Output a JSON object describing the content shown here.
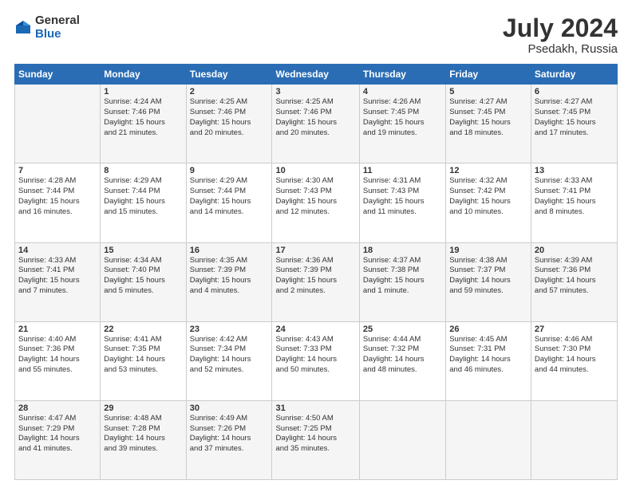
{
  "header": {
    "logo_general": "General",
    "logo_blue": "Blue",
    "title": "July 2024",
    "location": "Psedakh, Russia"
  },
  "weekdays": [
    "Sunday",
    "Monday",
    "Tuesday",
    "Wednesday",
    "Thursday",
    "Friday",
    "Saturday"
  ],
  "weeks": [
    [
      {
        "day": "",
        "info": ""
      },
      {
        "day": "1",
        "info": "Sunrise: 4:24 AM\nSunset: 7:46 PM\nDaylight: 15 hours\nand 21 minutes."
      },
      {
        "day": "2",
        "info": "Sunrise: 4:25 AM\nSunset: 7:46 PM\nDaylight: 15 hours\nand 20 minutes."
      },
      {
        "day": "3",
        "info": "Sunrise: 4:25 AM\nSunset: 7:46 PM\nDaylight: 15 hours\nand 20 minutes."
      },
      {
        "day": "4",
        "info": "Sunrise: 4:26 AM\nSunset: 7:45 PM\nDaylight: 15 hours\nand 19 minutes."
      },
      {
        "day": "5",
        "info": "Sunrise: 4:27 AM\nSunset: 7:45 PM\nDaylight: 15 hours\nand 18 minutes."
      },
      {
        "day": "6",
        "info": "Sunrise: 4:27 AM\nSunset: 7:45 PM\nDaylight: 15 hours\nand 17 minutes."
      }
    ],
    [
      {
        "day": "7",
        "info": "Sunrise: 4:28 AM\nSunset: 7:44 PM\nDaylight: 15 hours\nand 16 minutes."
      },
      {
        "day": "8",
        "info": "Sunrise: 4:29 AM\nSunset: 7:44 PM\nDaylight: 15 hours\nand 15 minutes."
      },
      {
        "day": "9",
        "info": "Sunrise: 4:29 AM\nSunset: 7:44 PM\nDaylight: 15 hours\nand 14 minutes."
      },
      {
        "day": "10",
        "info": "Sunrise: 4:30 AM\nSunset: 7:43 PM\nDaylight: 15 hours\nand 12 minutes."
      },
      {
        "day": "11",
        "info": "Sunrise: 4:31 AM\nSunset: 7:43 PM\nDaylight: 15 hours\nand 11 minutes."
      },
      {
        "day": "12",
        "info": "Sunrise: 4:32 AM\nSunset: 7:42 PM\nDaylight: 15 hours\nand 10 minutes."
      },
      {
        "day": "13",
        "info": "Sunrise: 4:33 AM\nSunset: 7:41 PM\nDaylight: 15 hours\nand 8 minutes."
      }
    ],
    [
      {
        "day": "14",
        "info": "Sunrise: 4:33 AM\nSunset: 7:41 PM\nDaylight: 15 hours\nand 7 minutes."
      },
      {
        "day": "15",
        "info": "Sunrise: 4:34 AM\nSunset: 7:40 PM\nDaylight: 15 hours\nand 5 minutes."
      },
      {
        "day": "16",
        "info": "Sunrise: 4:35 AM\nSunset: 7:39 PM\nDaylight: 15 hours\nand 4 minutes."
      },
      {
        "day": "17",
        "info": "Sunrise: 4:36 AM\nSunset: 7:39 PM\nDaylight: 15 hours\nand 2 minutes."
      },
      {
        "day": "18",
        "info": "Sunrise: 4:37 AM\nSunset: 7:38 PM\nDaylight: 15 hours\nand 1 minute."
      },
      {
        "day": "19",
        "info": "Sunrise: 4:38 AM\nSunset: 7:37 PM\nDaylight: 14 hours\nand 59 minutes."
      },
      {
        "day": "20",
        "info": "Sunrise: 4:39 AM\nSunset: 7:36 PM\nDaylight: 14 hours\nand 57 minutes."
      }
    ],
    [
      {
        "day": "21",
        "info": "Sunrise: 4:40 AM\nSunset: 7:36 PM\nDaylight: 14 hours\nand 55 minutes."
      },
      {
        "day": "22",
        "info": "Sunrise: 4:41 AM\nSunset: 7:35 PM\nDaylight: 14 hours\nand 53 minutes."
      },
      {
        "day": "23",
        "info": "Sunrise: 4:42 AM\nSunset: 7:34 PM\nDaylight: 14 hours\nand 52 minutes."
      },
      {
        "day": "24",
        "info": "Sunrise: 4:43 AM\nSunset: 7:33 PM\nDaylight: 14 hours\nand 50 minutes."
      },
      {
        "day": "25",
        "info": "Sunrise: 4:44 AM\nSunset: 7:32 PM\nDaylight: 14 hours\nand 48 minutes."
      },
      {
        "day": "26",
        "info": "Sunrise: 4:45 AM\nSunset: 7:31 PM\nDaylight: 14 hours\nand 46 minutes."
      },
      {
        "day": "27",
        "info": "Sunrise: 4:46 AM\nSunset: 7:30 PM\nDaylight: 14 hours\nand 44 minutes."
      }
    ],
    [
      {
        "day": "28",
        "info": "Sunrise: 4:47 AM\nSunset: 7:29 PM\nDaylight: 14 hours\nand 41 minutes."
      },
      {
        "day": "29",
        "info": "Sunrise: 4:48 AM\nSunset: 7:28 PM\nDaylight: 14 hours\nand 39 minutes."
      },
      {
        "day": "30",
        "info": "Sunrise: 4:49 AM\nSunset: 7:26 PM\nDaylight: 14 hours\nand 37 minutes."
      },
      {
        "day": "31",
        "info": "Sunrise: 4:50 AM\nSunset: 7:25 PM\nDaylight: 14 hours\nand 35 minutes."
      },
      {
        "day": "",
        "info": ""
      },
      {
        "day": "",
        "info": ""
      },
      {
        "day": "",
        "info": ""
      }
    ]
  ]
}
